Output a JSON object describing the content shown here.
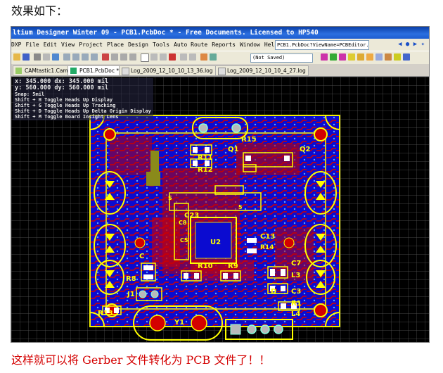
{
  "top_caption": "效果如下：",
  "bottom_caption": "这样就可以将 Gerber 文件转化为 PCB 文件了！！",
  "window": {
    "title": "ltium Designer Winter 09 - PCB1.PcbDoc * - Free Documents. Licensed to HP540",
    "menu": [
      "DXP",
      "File",
      "Edit",
      "View",
      "Project",
      "Place",
      "Design",
      "Tools",
      "Auto Route",
      "Reports",
      "Window",
      "Help"
    ],
    "path_box": "PCB1.PcbDoc?ViewName=PCBEditor.",
    "saved_state": "(Not Saved)"
  },
  "tabs": [
    {
      "label": "CAMtastic1.Cam *",
      "active": false
    },
    {
      "label": "PCB1.PcbDoc *",
      "active": true
    },
    {
      "label": "Log_2009_12_10_10_13_36.log",
      "active": false
    },
    {
      "label": "Log_2009_12_10_10_4_27.log",
      "active": false
    }
  ],
  "hud": {
    "x_label": "x:",
    "x_value": "345.000",
    "dx_label": "dx:",
    "dx_value": "345.000 mil",
    "y_label": "y:",
    "y_value": "560.000",
    "dy_label": "dy:",
    "dy_value": "560.000 mil",
    "snap": "Snap: 5mil",
    "hints": [
      "Shift + H  Toggle Heads Up Display",
      "Shift + G  Toggle Heads Up Tracking",
      "Shift + D  Toggle Heads Up Delta Origin Display",
      "Shift + M  Toggle Board Insight Lens"
    ]
  },
  "designators": [
    "R15",
    "Q1",
    "Q2",
    "R11",
    "R12",
    "C23",
    "C5",
    "C8",
    "U2",
    "C13",
    "R14",
    "R10",
    "R9",
    "C7",
    "R8",
    "L3",
    "C3",
    "J1",
    "R1",
    "R13",
    "L4",
    "Y1",
    "C",
    "D",
    "5",
    "S"
  ],
  "colors": {
    "board": "#0b0bd0",
    "top_copper": "#d40000",
    "silk": "#ffff00",
    "grid": "#5a5a5a",
    "pad": "#b9b9b9",
    "keepout": "#f0f000"
  }
}
